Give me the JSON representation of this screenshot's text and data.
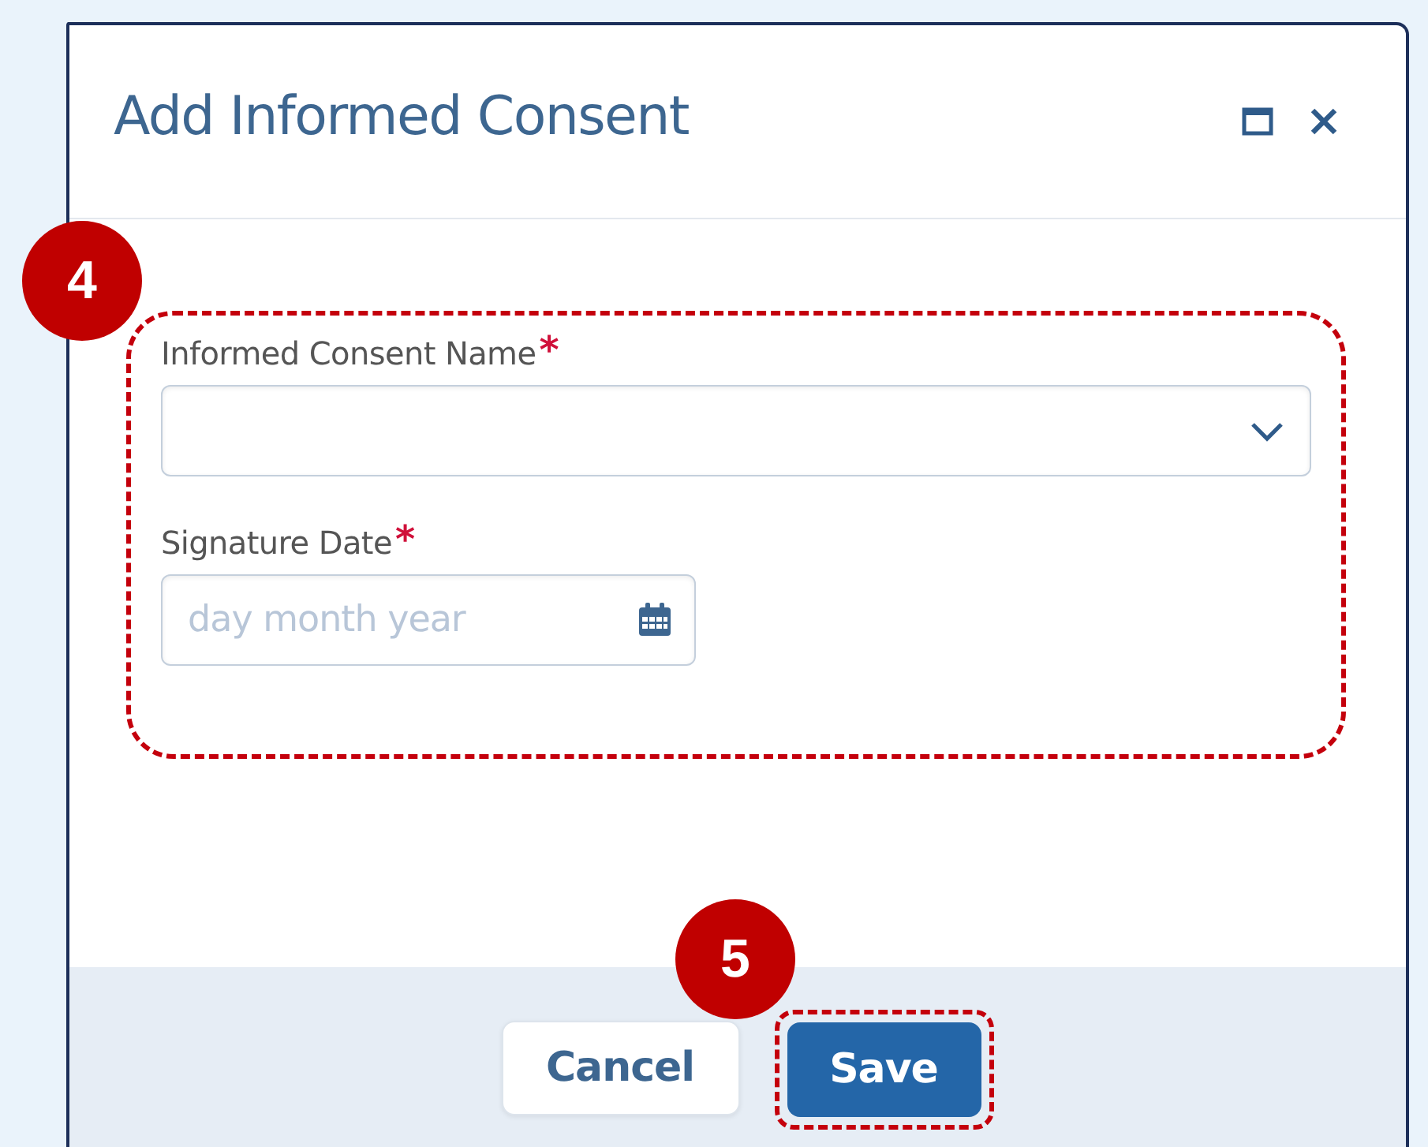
{
  "dialog": {
    "title": "Add Informed Consent",
    "fields": [
      {
        "kind": "select",
        "label": "Informed Consent Name",
        "required_mark": "*"
      },
      {
        "kind": "date",
        "label": "Signature Date",
        "required_mark": "*",
        "placeholder": "day month year"
      }
    ],
    "buttons": [
      {
        "label": "Cancel",
        "kind": "secondary"
      },
      {
        "label": "Save",
        "kind": "primary"
      }
    ]
  },
  "callouts": [
    {
      "number": "4"
    },
    {
      "number": "5"
    }
  ]
}
